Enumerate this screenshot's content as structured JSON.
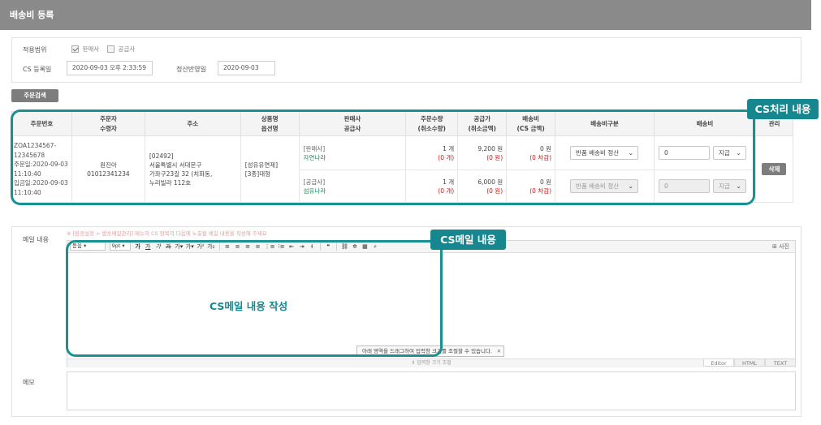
{
  "page": {
    "title": "배송비 등록"
  },
  "form": {
    "scope_label": "적용범위",
    "scope_options": [
      {
        "label": "판매사",
        "checked": true
      },
      {
        "label": "공급사",
        "checked": false
      }
    ],
    "cs_date_label": "CS 등록일",
    "cs_date_value": "2020-09-03 오후 2:33:59",
    "settle_date_label": "정산반영일",
    "settle_date_value": "2020-09-03"
  },
  "order_search_button": "주문검색",
  "table": {
    "headers": {
      "order_no": "주문번호",
      "orderer": [
        "주문자",
        "수령자"
      ],
      "address": "주소",
      "product": [
        "상품명",
        "옵션명"
      ],
      "seller": [
        "판매사",
        "공급사"
      ],
      "qty": [
        "주문수량",
        "(취소수량)"
      ],
      "price": [
        "공급가",
        "(취소금액)"
      ],
      "shipping": [
        "배송비",
        "(CS 금액)"
      ],
      "shipping_type": "배송비구분",
      "shipping_fee": "배송비",
      "manage": "관리"
    },
    "order": {
      "order_no_lines": [
        "ZOA1234567-",
        "12345678",
        "주문일:2020-09-03",
        "11:10:40",
        "입금일:2020-09-03",
        "11:10:40"
      ],
      "orderer_name": "원진아",
      "orderer_phone": "01012341234",
      "address_lines": [
        "[02492]",
        "서울특별시 서대문구",
        "가좌구23길 32 (치화동,",
        "누리빌라 112호"
      ],
      "product_lines": [
        "[성유유연제]",
        "[3종]대형"
      ]
    },
    "rows": [
      {
        "party_tag": "[판매사]",
        "party_name": "자연나라",
        "qty": "1 개",
        "qty_cancel": "(0 개)",
        "price": "9,200 원",
        "price_cancel": "(0 원)",
        "ship": "0 원",
        "ship_cs": "(0 차감)",
        "ship_type": "반품 배송비 정산",
        "fee_value": "0",
        "fee_mode": "지급",
        "disabled": false
      },
      {
        "party_tag": "[공급사]",
        "party_name": "섬유나라",
        "qty": "1 개",
        "qty_cancel": "(0 개)",
        "price": "6,000 원",
        "price_cancel": "(0 원)",
        "ship": "0 원",
        "ship_cs": "(0 차감)",
        "ship_type": "반품 배송비 정산",
        "fee_value": "0",
        "fee_mode": "지급",
        "disabled": true
      }
    ],
    "delete_button": "삭제"
  },
  "callouts": {
    "cs_process": "CS처리 내용",
    "cs_mail": "CS메일 내용",
    "cs_mail_write": "CS메일 내용 작성"
  },
  "mail": {
    "label": "메일 내용",
    "hint": "※ [환경설정 > 발송메일관리] 메뉴의 CS 항목의 다음에 노출될 메일 내용을 작성해 주세요",
    "toolbar": {
      "font": "돋움",
      "size": "9pt",
      "items": [
        "가",
        "가",
        "가",
        "가",
        "가",
        "가",
        "가",
        "가",
        "가",
        "가"
      ]
    },
    "photo_button": "사진",
    "resize_tip": "아래 영역을 드래그하여 입력창 크기를 조절할 수 있습니다.",
    "resize_bar": "입력창 크기 조절",
    "tabs": [
      "Editor",
      "HTML",
      "TEXT"
    ]
  },
  "memo": {
    "label": "메모"
  }
}
